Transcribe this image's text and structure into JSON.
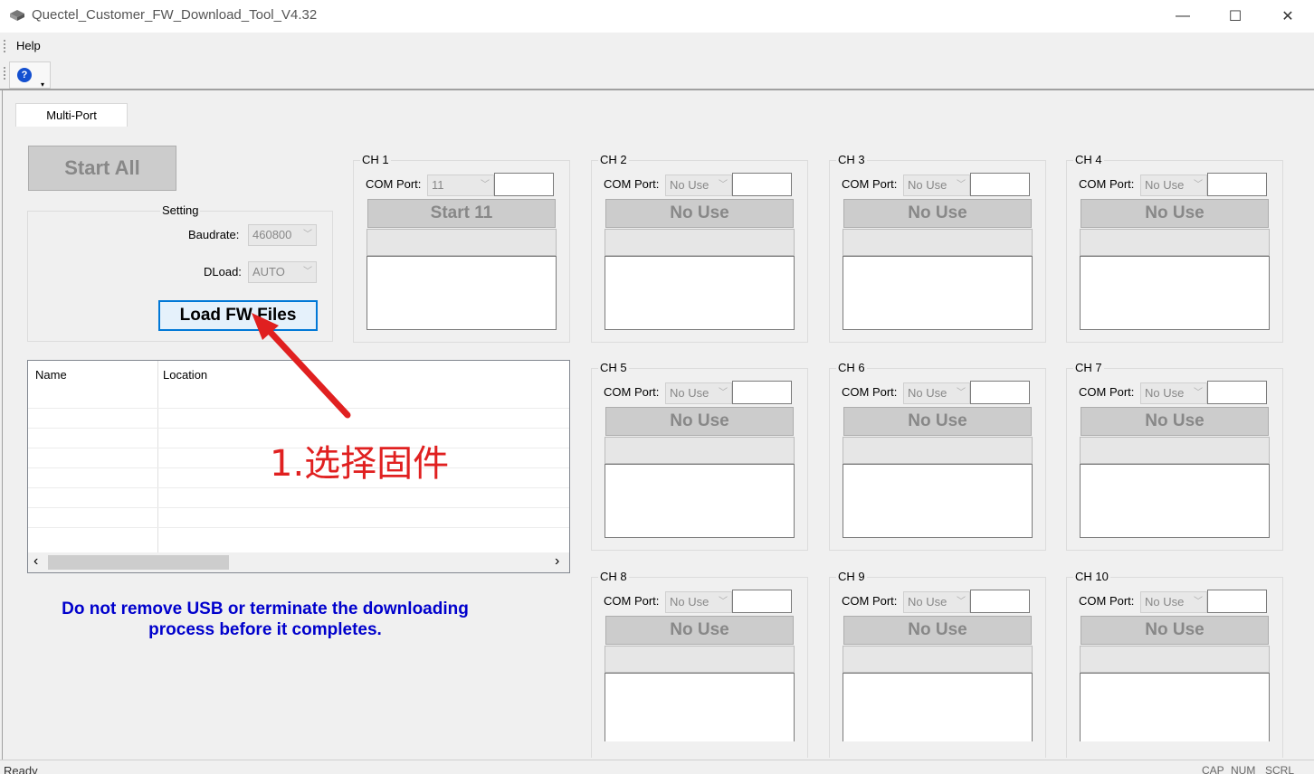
{
  "window": {
    "title": "Quectel_Customer_FW_Download_Tool_V4.32",
    "minimize": "—",
    "maximize": "☐",
    "close": "✕"
  },
  "menu": {
    "help": "Help"
  },
  "toolbar": {
    "help_icon": "?",
    "dropdown": "▾"
  },
  "tab": {
    "label": "Multi-Port"
  },
  "start_all": "Start All",
  "setting": {
    "title": "Setting",
    "baudrate_label": "Baudrate:",
    "baudrate_value": "460800",
    "dload_label": "DLoad:",
    "dload_value": "AUTO"
  },
  "load_button": "Load FW Files",
  "file_list": {
    "columns": [
      "Name",
      "Location"
    ],
    "rows": []
  },
  "scroll": {
    "left": "‹",
    "right": "›"
  },
  "notice_line1": "Do not remove USB or terminate the downloading",
  "notice_line2": "process before it completes.",
  "annotation": "1.选择固件",
  "channels": [
    {
      "label": "CH 1",
      "com_label": "COM Port:",
      "port": "11",
      "button": "Start 11"
    },
    {
      "label": "CH 2",
      "com_label": "COM Port:",
      "port": "No Use",
      "button": "No Use"
    },
    {
      "label": "CH 3",
      "com_label": "COM Port:",
      "port": "No Use",
      "button": "No Use"
    },
    {
      "label": "CH 4",
      "com_label": "COM Port:",
      "port": "No Use",
      "button": "No Use"
    },
    {
      "label": "CH 5",
      "com_label": "COM Port:",
      "port": "No Use",
      "button": "No Use"
    },
    {
      "label": "CH 6",
      "com_label": "COM Port:",
      "port": "No Use",
      "button": "No Use"
    },
    {
      "label": "CH 7",
      "com_label": "COM Port:",
      "port": "No Use",
      "button": "No Use"
    },
    {
      "label": "CH 8",
      "com_label": "COM Port:",
      "port": "No Use",
      "button": "No Use"
    },
    {
      "label": "CH 9",
      "com_label": "COM Port:",
      "port": "No Use",
      "button": "No Use"
    },
    {
      "label": "CH 10",
      "com_label": "COM Port:",
      "port": "No Use",
      "button": "No Use"
    }
  ],
  "status": {
    "text": "Ready",
    "cap": "CAP",
    "num": "NUM",
    "scrl": "SCRL"
  },
  "colors": {
    "annotation": "#e02020",
    "notice": "#0000cc",
    "accent": "#0078d7"
  }
}
